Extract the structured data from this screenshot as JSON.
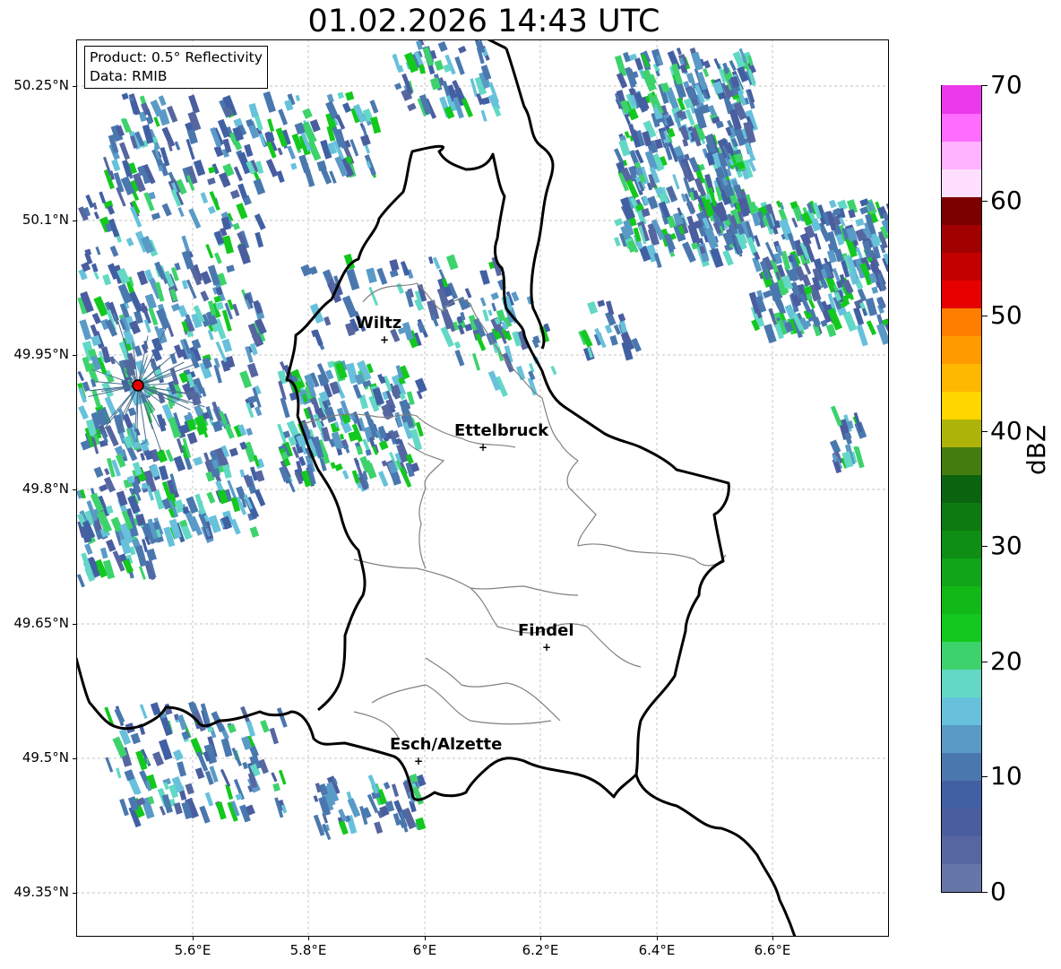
{
  "title": "01.02.2026 14:43 UTC",
  "info": {
    "product": "Product: 0.5° Reflectivity",
    "data": "Data: RMIB"
  },
  "axes": {
    "lat_labels": [
      "50.25°N",
      "50.1°N",
      "49.95°N",
      "49.8°N",
      "49.65°N",
      "49.5°N",
      "49.35°N"
    ],
    "lon_labels": [
      "5.6°E",
      "5.8°E",
      "6°E",
      "6.2°E",
      "6.4°E",
      "6.6°E"
    ]
  },
  "cities": [
    {
      "name": "Wiltz"
    },
    {
      "name": "Ettelbruck"
    },
    {
      "name": "Findel"
    },
    {
      "name": "Esch/Alzette"
    }
  ],
  "colorbar": {
    "title": "dBZ",
    "tick_labels": [
      "0",
      "10",
      "20",
      "30",
      "40",
      "50",
      "60",
      "70"
    ],
    "colors": [
      "#6776a8",
      "#5666a0",
      "#4a5e9f",
      "#4160a3",
      "#4a78ae",
      "#5a9ac6",
      "#67c1db",
      "#63d8c6",
      "#3ed26d",
      "#13c81e",
      "#12b916",
      "#11a51a",
      "#0e8e14",
      "#0c7a11",
      "#0a6410",
      "#457c10",
      "#adb309",
      "#fed600",
      "#ffb801",
      "#ff9a00",
      "#ff7e00",
      "#e60000",
      "#c20000",
      "#a20000",
      "#7c0000",
      "#ffdfff",
      "#ffb2ff",
      "#ff6cff",
      "#ec39ec"
    ]
  }
}
